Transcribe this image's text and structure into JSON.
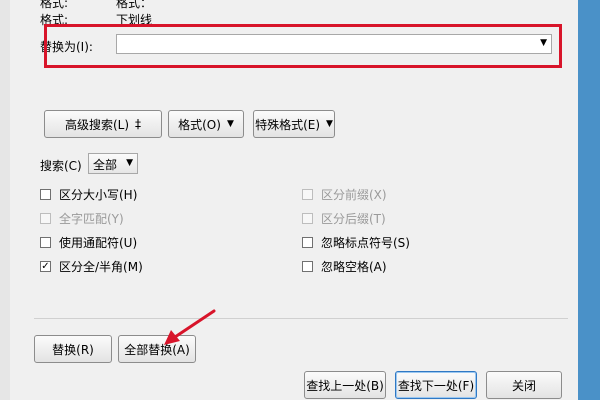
{
  "top": {
    "cut_label": "格式:",
    "cut_value": "格式：",
    "format_label": "格式:",
    "format_value": "下划线"
  },
  "replace": {
    "label": "替换为(I):",
    "value": ""
  },
  "buttons": {
    "advanced": "高级搜索(L)",
    "advanced_icon": "‡",
    "format": "格式(O)",
    "special": "特殊格式(E)",
    "replace": "替换(R)",
    "replace_all": "全部替换(A)",
    "find_prev": "查找上一处(B)",
    "find_next": "查找下一处(F)",
    "close": "关闭"
  },
  "search": {
    "label": "搜索(C)",
    "value": "全部"
  },
  "options": {
    "match_case": "区分大小写(H)",
    "whole_word": "全字匹配(Y)",
    "wildcards": "使用通配符(U)",
    "full_half": "区分全/半角(M)",
    "prefix": "区分前缀(X)",
    "suffix": "区分后缀(T)",
    "ignore_punct": "忽略标点符号(S)",
    "ignore_space": "忽略空格(A)"
  },
  "checked_mark": "✓",
  "colors": {
    "highlight": "#d8142a",
    "accent": "#2f78c4"
  }
}
